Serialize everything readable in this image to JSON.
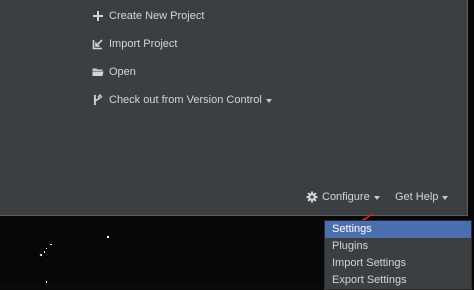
{
  "welcome": {
    "actions": [
      {
        "label": "Create New Project",
        "icon": "plus-icon"
      },
      {
        "label": "Import Project",
        "icon": "import-icon"
      },
      {
        "label": "Open",
        "icon": "folder-icon"
      },
      {
        "label": "Check out from Version Control",
        "icon": "vcs-branch-icon",
        "has_dropdown": true
      }
    ],
    "footer": {
      "configure_label": "Configure",
      "configure_icon": "gear-icon",
      "get_help_label": "Get Help"
    }
  },
  "configure_menu": {
    "items": [
      {
        "label": "Settings",
        "selected": true
      },
      {
        "label": "Plugins",
        "selected": false
      },
      {
        "label": "Import Settings",
        "selected": false
      },
      {
        "label": "Export Settings",
        "selected": false
      }
    ]
  },
  "colors": {
    "window_bg": "#3c3f41",
    "text": "#d4d4d4",
    "selection": "#4b6eaf",
    "annotation": "#e02020"
  }
}
